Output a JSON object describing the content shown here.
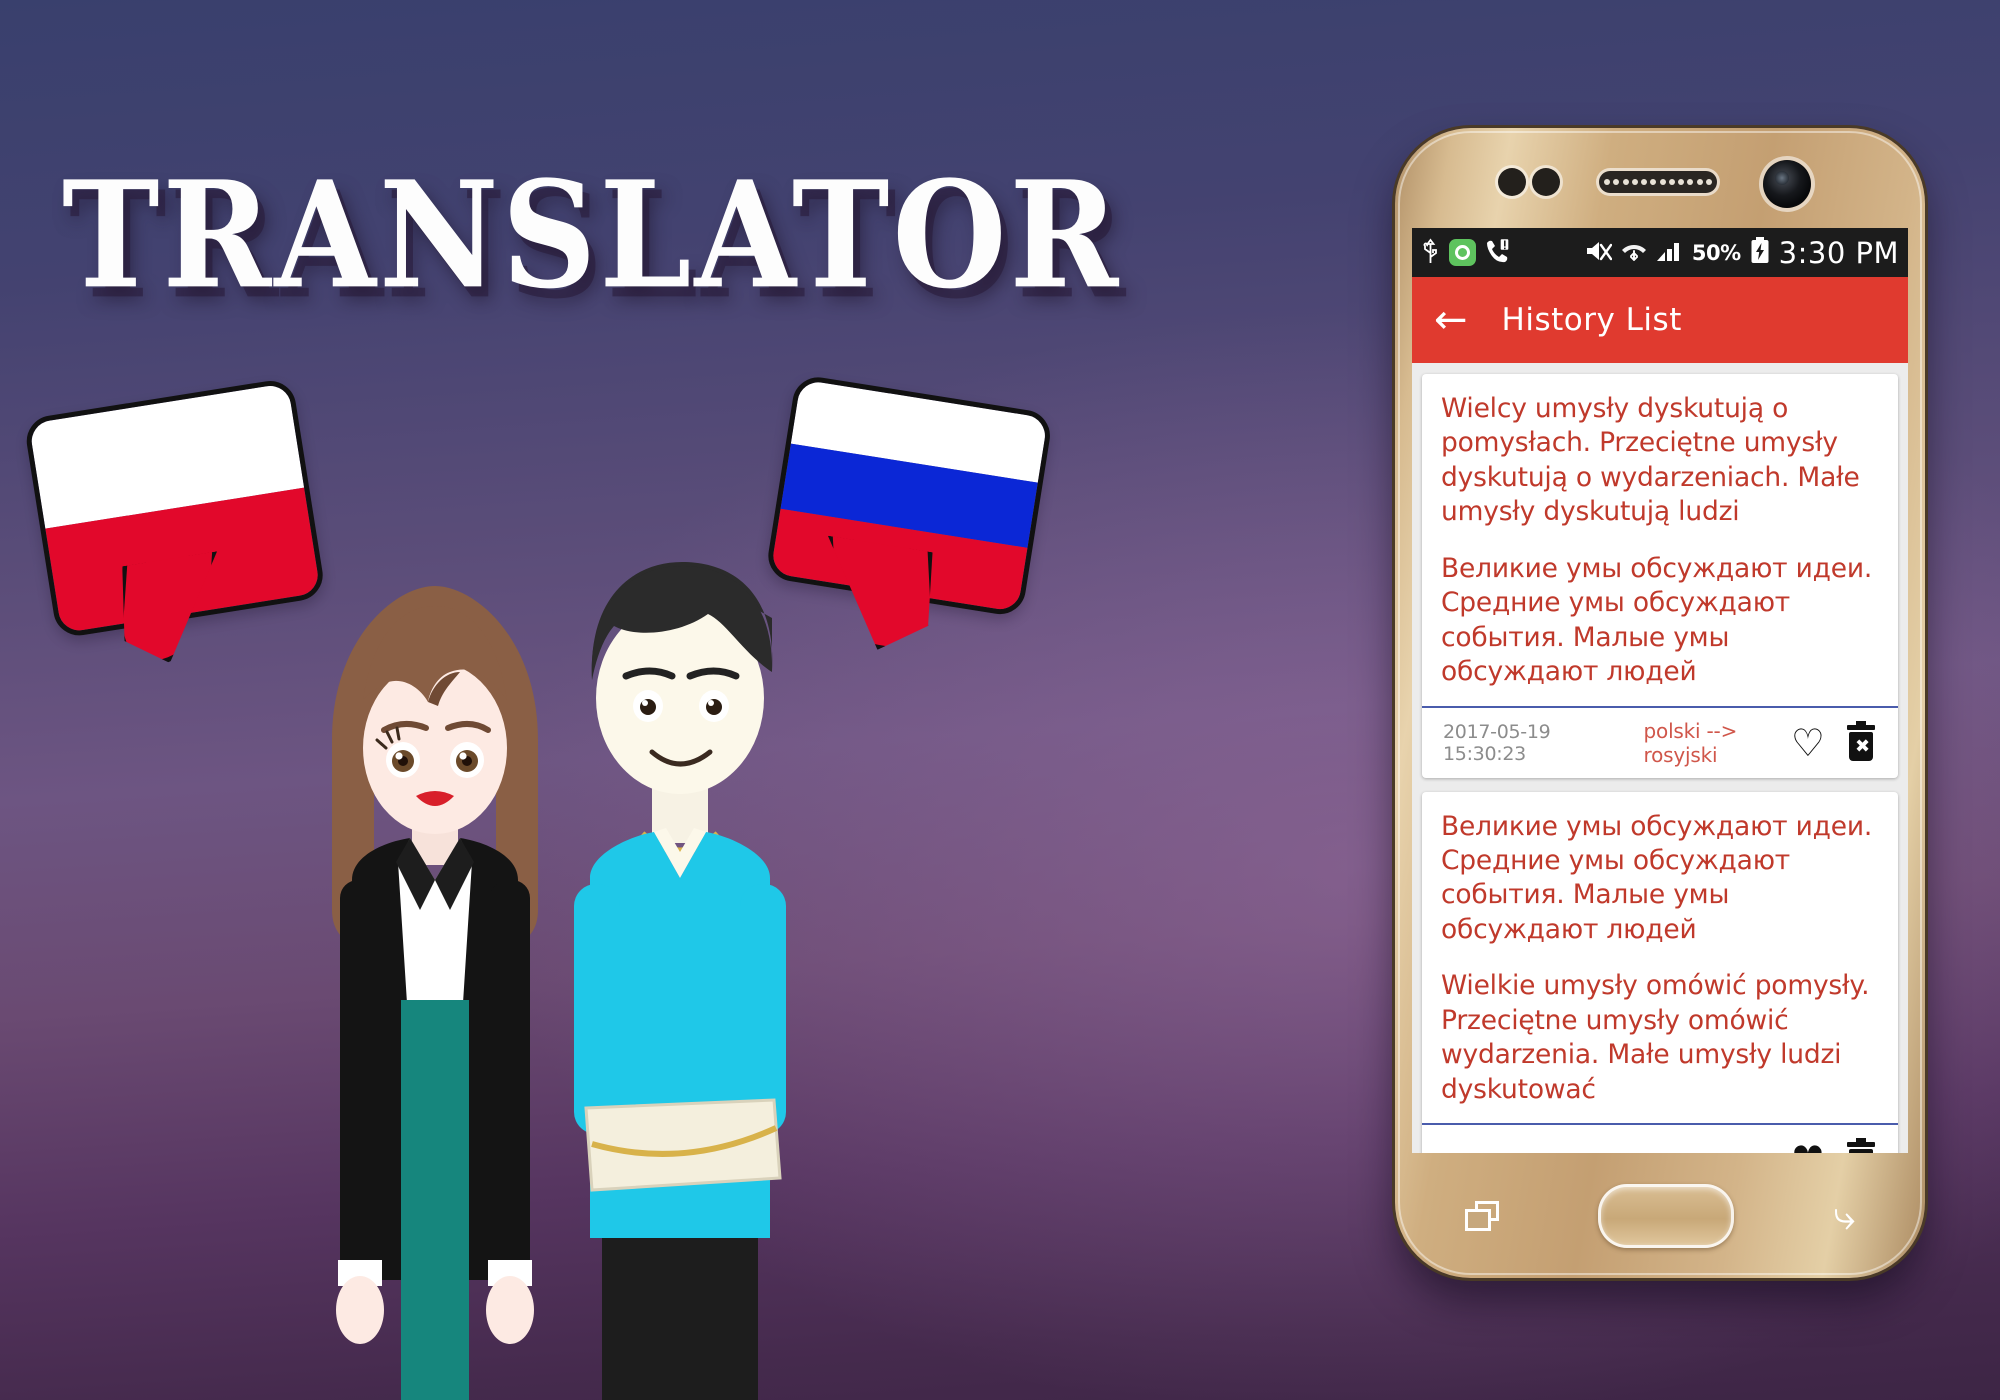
{
  "poster": {
    "title": "TRANSLATOR",
    "background_top_color": "#39406d",
    "background_mid_color": "#6d5582",
    "background_bottom_color": "#3d2545",
    "bubbles": [
      {
        "name": "polish-flag-bubble",
        "flag": "Poland",
        "colors": [
          "#ffffff",
          "#e2082b"
        ]
      },
      {
        "name": "russian-flag-bubble",
        "flag": "Russia",
        "colors": [
          "#ffffff",
          "#0b27d6",
          "#e2082b"
        ]
      }
    ],
    "characters": [
      {
        "name": "woman-character",
        "hair": "#8a5f45",
        "jacket": "#151515",
        "dress": "#16867d"
      },
      {
        "name": "man-character",
        "hair": "#2b2b2b",
        "shirt": "#1fc8e8"
      }
    ]
  },
  "phone": {
    "status_bar": {
      "usb_icon": "usb-icon",
      "app_icon": "green-circle-icon",
      "missed_call_icon": "missed-call-icon",
      "mute_icon": "mute-icon",
      "wifi_icon": "wifi-icon",
      "signal_icon": "signal-bars-icon",
      "battery_percent": "50%",
      "battery_icon": "charging-battery-icon",
      "time": "3:30 PM"
    },
    "appbar": {
      "back_icon": "back-arrow-icon",
      "title": "History List",
      "color": "#e03a2f"
    },
    "history": {
      "cards": [
        {
          "source_text": "Wielcy umysły dyskutują o pomysłach. Przeciętne umysły dyskutują o wydarzeniach. Małe umysły dyskutują ludzi",
          "target_text": "Великие умы обсуждают идеи. Средние умы обсуждают события. Малые умы обсуждают людей",
          "date": "2017-05-19 15:30:23",
          "pair": "polski --> rosyjski",
          "favorite_icon": "heart-outline-icon",
          "delete_icon": "trash-delete-icon"
        },
        {
          "source_text": "Великие умы обсуждают идеи. Средние умы обсуждают события. Малые умы обсуждают людей",
          "target_text": "Wielkie umysły omówić pomysły. Przeciętne umysły omówić wydarzenia. Małe umysły ludzi dyskutować",
          "date": "",
          "pair": "",
          "favorite_icon": "heart-filled-icon",
          "delete_icon": "trash-delete-icon"
        }
      ],
      "text_color": "#c0392b",
      "date_color": "#8c8c8c",
      "pair_color": "#d0564a"
    },
    "navbar": {
      "recent_icon": "recent-apps-icon",
      "home_button": "home-button",
      "back_icon": "nav-back-icon"
    }
  }
}
